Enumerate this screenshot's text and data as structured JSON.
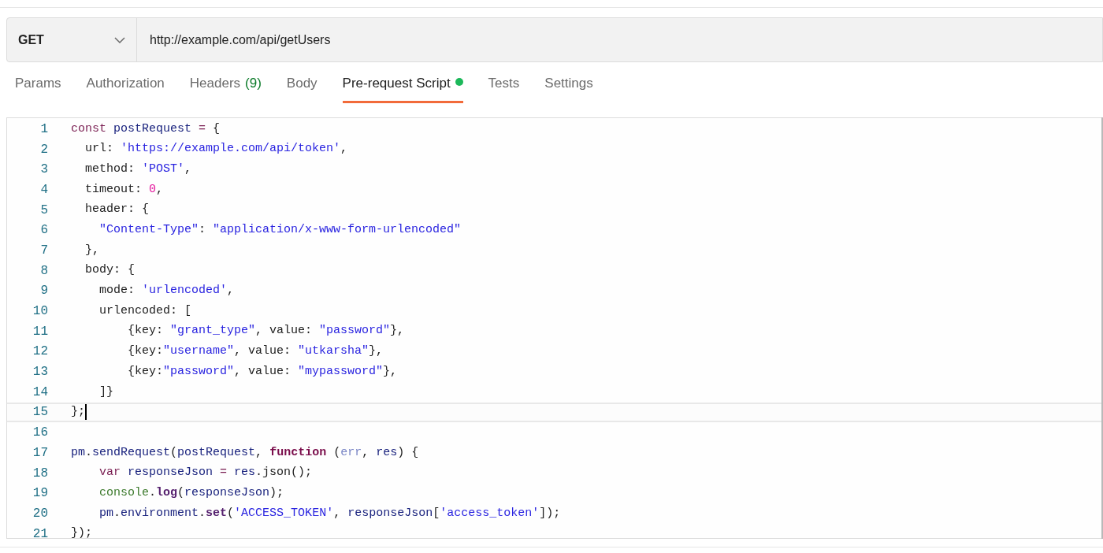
{
  "request": {
    "method": "GET",
    "url": "http://example.com/api/getUsers"
  },
  "tabs": [
    {
      "label": "Params",
      "selected": false,
      "indicator": false
    },
    {
      "label": "Authorization",
      "selected": false,
      "indicator": false
    },
    {
      "label": "Headers",
      "count": "(9)",
      "selected": false,
      "indicator": false
    },
    {
      "label": "Body",
      "selected": false,
      "indicator": false
    },
    {
      "label": "Pre-request Script",
      "selected": true,
      "indicator": true
    },
    {
      "label": "Tests",
      "selected": false,
      "indicator": false
    },
    {
      "label": "Settings",
      "selected": false,
      "indicator": false
    }
  ],
  "editor": {
    "lines": [
      {
        "number": "1",
        "active": false,
        "tokens": [
          {
            "kind": "keyword",
            "text": "const"
          },
          {
            "kind": "variable",
            "text": " postRequest"
          },
          {
            "kind": "keyword",
            "text": " ="
          },
          {
            "kind": "plain",
            "text": " {"
          }
        ]
      },
      {
        "number": "2",
        "active": false,
        "tokens": [
          {
            "kind": "plain",
            "text": "  url: "
          },
          {
            "kind": "string",
            "text": "'https://example.com/api/token'"
          },
          {
            "kind": "plain",
            "text": ","
          }
        ]
      },
      {
        "number": "3",
        "active": false,
        "tokens": [
          {
            "kind": "plain",
            "text": "  method: "
          },
          {
            "kind": "string",
            "text": "'POST'"
          },
          {
            "kind": "plain",
            "text": ","
          }
        ]
      },
      {
        "number": "4",
        "active": false,
        "tokens": [
          {
            "kind": "plain",
            "text": "  timeout: "
          },
          {
            "kind": "number",
            "text": "0"
          },
          {
            "kind": "plain",
            "text": ","
          }
        ]
      },
      {
        "number": "5",
        "active": false,
        "tokens": [
          {
            "kind": "plain",
            "text": "  header: {"
          }
        ]
      },
      {
        "number": "6",
        "active": false,
        "tokens": [
          {
            "kind": "string",
            "text": "    \"Content-Type\""
          },
          {
            "kind": "plain",
            "text": ": "
          },
          {
            "kind": "string",
            "text": "\"application/x-www-form-urlencoded\""
          }
        ]
      },
      {
        "number": "7",
        "active": false,
        "tokens": [
          {
            "kind": "plain",
            "text": "  },"
          }
        ]
      },
      {
        "number": "8",
        "active": false,
        "tokens": [
          {
            "kind": "plain",
            "text": "  body: {"
          }
        ]
      },
      {
        "number": "9",
        "active": false,
        "tokens": [
          {
            "kind": "plain",
            "text": "    mode: "
          },
          {
            "kind": "string",
            "text": "'urlencoded'"
          },
          {
            "kind": "plain",
            "text": ","
          }
        ]
      },
      {
        "number": "10",
        "active": false,
        "tokens": [
          {
            "kind": "plain",
            "text": "    urlencoded: ["
          }
        ]
      },
      {
        "number": "11",
        "active": false,
        "tokens": [
          {
            "kind": "plain",
            "text": "        {key: "
          },
          {
            "kind": "string",
            "text": "\"grant_type\""
          },
          {
            "kind": "plain",
            "text": ", value: "
          },
          {
            "kind": "string",
            "text": "\"password\""
          },
          {
            "kind": "plain",
            "text": "},"
          }
        ]
      },
      {
        "number": "12",
        "active": false,
        "tokens": [
          {
            "kind": "plain",
            "text": "        {key:"
          },
          {
            "kind": "string",
            "text": "\"username\""
          },
          {
            "kind": "plain",
            "text": ", value: "
          },
          {
            "kind": "string",
            "text": "\"utkarsha\""
          },
          {
            "kind": "plain",
            "text": "},"
          }
        ]
      },
      {
        "number": "13",
        "active": false,
        "tokens": [
          {
            "kind": "plain",
            "text": "        {key:"
          },
          {
            "kind": "string",
            "text": "\"password\""
          },
          {
            "kind": "plain",
            "text": ", value: "
          },
          {
            "kind": "string",
            "text": "\"mypassword\""
          },
          {
            "kind": "plain",
            "text": "},"
          }
        ]
      },
      {
        "number": "14",
        "active": false,
        "tokens": [
          {
            "kind": "plain",
            "text": "    ]}"
          }
        ]
      },
      {
        "number": "15",
        "active": true,
        "tokens": [
          {
            "kind": "plain",
            "text": "};"
          }
        ]
      },
      {
        "number": "16",
        "active": false
      },
      {
        "number": "17",
        "active": false,
        "tokens": [
          {
            "kind": "variable",
            "text": "pm"
          },
          {
            "kind": "plain",
            "text": "."
          },
          {
            "kind": "variable",
            "text": "sendRequest"
          },
          {
            "kind": "plain",
            "text": "("
          },
          {
            "kind": "variable",
            "text": "postRequest"
          },
          {
            "kind": "plain",
            "text": ","
          },
          {
            "kind": "function",
            "text": " function"
          },
          {
            "kind": "plain",
            "text": " ("
          },
          {
            "kind": "param",
            "text": "err"
          },
          {
            "kind": "plain",
            "text": ","
          },
          {
            "kind": "variable",
            "text": " res"
          },
          {
            "kind": "plain",
            "text": ") {"
          }
        ]
      },
      {
        "number": "18",
        "active": false,
        "tokens": [
          {
            "kind": "keyword",
            "text": "    var"
          },
          {
            "kind": "variable",
            "text": " responseJson"
          },
          {
            "kind": "keyword",
            "text": " ="
          },
          {
            "kind": "variable",
            "text": " res"
          },
          {
            "kind": "plain",
            "text": ".json();"
          }
        ]
      },
      {
        "number": "19",
        "active": false,
        "tokens": [
          {
            "kind": "builtin",
            "text": "    console"
          },
          {
            "kind": "plain",
            "text": "."
          },
          {
            "kind": "method",
            "text": "log"
          },
          {
            "kind": "plain",
            "text": "("
          },
          {
            "kind": "variable",
            "text": "responseJson"
          },
          {
            "kind": "plain",
            "text": ");"
          }
        ]
      },
      {
        "number": "20",
        "active": false,
        "tokens": [
          {
            "kind": "variable",
            "text": "    pm"
          },
          {
            "kind": "plain",
            "text": "."
          },
          {
            "kind": "variable",
            "text": "environment"
          },
          {
            "kind": "plain",
            "text": "."
          },
          {
            "kind": "method",
            "text": "set"
          },
          {
            "kind": "plain",
            "text": "("
          },
          {
            "kind": "string",
            "text": "'ACCESS_TOKEN'"
          },
          {
            "kind": "plain",
            "text": ","
          },
          {
            "kind": "variable",
            "text": " responseJson"
          },
          {
            "kind": "plain",
            "text": "["
          },
          {
            "kind": "string",
            "text": "'access_token'"
          },
          {
            "kind": "plain",
            "text": "]);"
          }
        ]
      },
      {
        "number": "21",
        "active": false,
        "tokens": [
          {
            "kind": "plain",
            "text": "});"
          }
        ]
      }
    ]
  }
}
